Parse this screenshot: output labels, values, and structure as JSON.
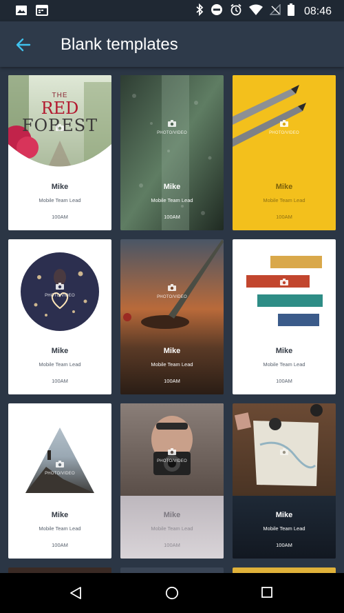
{
  "status_bar": {
    "time": "08:46",
    "left_icons": [
      "image-icon",
      "calendar-icon"
    ],
    "right_icons": [
      "bluetooth-icon",
      "do-not-disturb-icon",
      "alarm-icon",
      "wifi-icon",
      "no-signal-icon",
      "battery-icon"
    ]
  },
  "app_bar": {
    "title": "Blank templates",
    "back_icon": "arrow-left-icon",
    "accent": "#3fc2ee"
  },
  "photo_placeholder_label": "PHOTO/VIDEO",
  "cards": [
    {
      "name": "Mike",
      "role": "Mobile Team Lead",
      "time": "100AM",
      "art_text": [
        "THE",
        "RED",
        "FOREST"
      ]
    },
    {
      "name": "Mike",
      "role": "Mobile Team Lead",
      "time": "100AM"
    },
    {
      "name": "Mike",
      "role": "Mobile Team Lead",
      "time": "100AM"
    },
    {
      "name": "Mike",
      "role": "Mobile Team Lead",
      "time": "100AM"
    },
    {
      "name": "Mike",
      "role": "Mobile Team Lead",
      "time": "100AM"
    },
    {
      "name": "Mike",
      "role": "Mobile Team Lead",
      "time": "100AM"
    },
    {
      "name": "Mike",
      "role": "Mobile Team Lead",
      "time": "100AM"
    },
    {
      "name": "Mike",
      "role": "Mobile Team Lead",
      "time": "100AM"
    },
    {
      "name": "Mike",
      "role": "Mobile Team Lead",
      "time": "100AM"
    }
  ],
  "nav_bar": {
    "icons": [
      "back-triangle-icon",
      "home-circle-icon",
      "recents-square-icon"
    ]
  }
}
